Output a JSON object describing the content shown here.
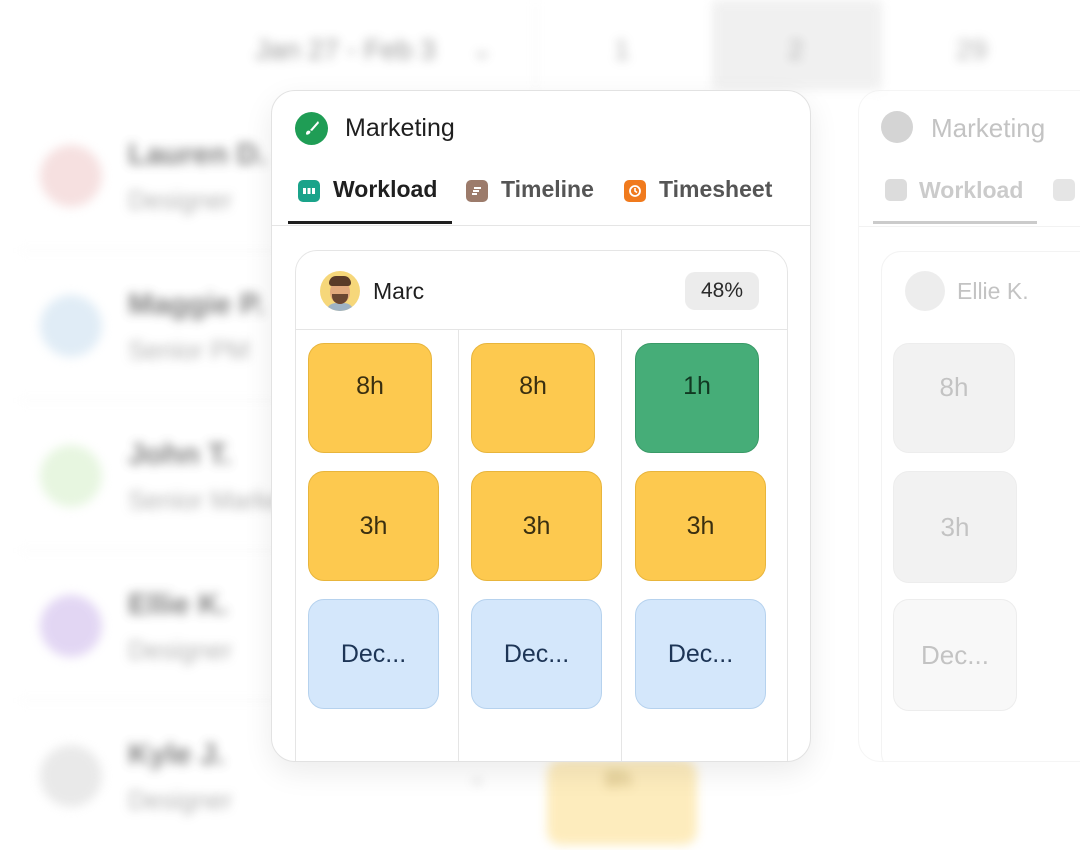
{
  "background": {
    "date_range": "Jan 27 - Feb 3",
    "days": [
      "1",
      "2",
      "29"
    ],
    "people": [
      {
        "name": "Lauren D.",
        "role": "Designer",
        "avatar_color": "#f3d6d6"
      },
      {
        "name": "Maggie P.",
        "role": "Senior PM",
        "avatar_color": "#d6e6f3"
      },
      {
        "name": "John T.",
        "role": "Senior Marketing",
        "avatar_color": "#dff3d6"
      },
      {
        "name": "Ellie K.",
        "role": "Designer",
        "avatar_color": "#d9c9f0"
      },
      {
        "name": "Kyle J.",
        "role": "Designer",
        "avatar_color": "#e2e2e2"
      }
    ],
    "bottom_block": "8h"
  },
  "card": {
    "title": "Marketing",
    "brand_color": "#1f9d55",
    "tabs": [
      {
        "label": "Workload",
        "icon": "workload-icon",
        "color": "#1aa38a",
        "active": true
      },
      {
        "label": "Timeline",
        "icon": "timeline-icon",
        "color": "#9c7b6b",
        "active": false
      },
      {
        "label": "Timesheet",
        "icon": "clock-icon",
        "color": "#f07a1d",
        "active": false
      }
    ],
    "person": {
      "name": "Marc",
      "utilization": "48%"
    },
    "cells": [
      [
        "8h",
        "8h",
        "1h"
      ],
      [
        "3h",
        "3h",
        "3h"
      ],
      [
        "Dec...",
        "Dec...",
        "Dec..."
      ]
    ]
  },
  "ghost_card": {
    "title": "Marketing",
    "tab": "Workload",
    "person": {
      "name": "Ellie K."
    },
    "cells": [
      "8h",
      "3h",
      "Dec..."
    ]
  }
}
